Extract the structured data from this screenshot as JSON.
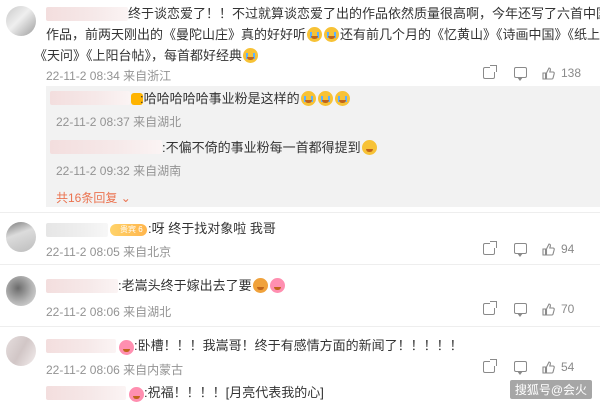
{
  "comments": [
    {
      "lines": [
        "终于谈恋爱了！！不过就算谈恋爱了出的作品依然质量很高啊，今年还写了六首中国风",
        "作品，前两天刚出的《曼陀山庄》真的好好听",
        "还有前几个月的《忆黄山》《诗画中国》《纸上雪》",
        "《天问》《上阳台帖》，每首都好经典"
      ],
      "meta": "22-11-2 08:34 来自浙江",
      "likes": "138"
    },
    {
      "text": ":呀  终于找对象啦 我哥",
      "meta": "22-11-2 08:05 来自北京",
      "likes": "94"
    },
    {
      "text": ":老嵩头终于嫁出去了要",
      "meta": "22-11-2 08:06 来自湖北",
      "likes": "70"
    },
    {
      "text": ":卧槽！！！我嵩哥！终于有感情方面的新闻了！！！！！",
      "meta": "22-11-2 08:06 来自内蒙古",
      "likes": "54"
    },
    {
      "text": ":祝福！！！！[月亮代表我的心]"
    }
  ],
  "replies": [
    {
      "text": ":哈哈哈哈哈事业粉是这样的",
      "meta": "22-11-2 08:37 来自湖北"
    },
    {
      "text": ":不偏不倚的事业粉每一首都得提到",
      "meta": "22-11-2 09:32 来自湖南"
    }
  ],
  "more_replies": "共16条回复",
  "vip_label": "贵宾 6",
  "watermark": "搜狐号@会火",
  "icons": {
    "share": "share-icon",
    "comment": "comment-icon",
    "like": "thumbs-up-icon"
  },
  "colors": {
    "link": "#eb7350",
    "meta": "#939393"
  }
}
